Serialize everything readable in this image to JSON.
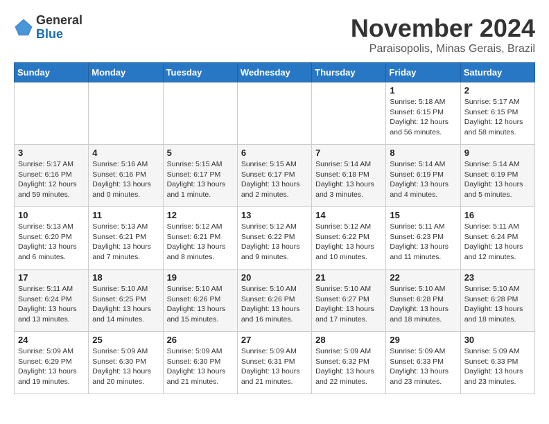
{
  "logo": {
    "general": "General",
    "blue": "Blue"
  },
  "header": {
    "month": "November 2024",
    "location": "Paraisopolis, Minas Gerais, Brazil"
  },
  "weekdays": [
    "Sunday",
    "Monday",
    "Tuesday",
    "Wednesday",
    "Thursday",
    "Friday",
    "Saturday"
  ],
  "weeks": [
    [
      {
        "day": "",
        "info": ""
      },
      {
        "day": "",
        "info": ""
      },
      {
        "day": "",
        "info": ""
      },
      {
        "day": "",
        "info": ""
      },
      {
        "day": "",
        "info": ""
      },
      {
        "day": "1",
        "info": "Sunrise: 5:18 AM\nSunset: 6:15 PM\nDaylight: 12 hours and 56 minutes."
      },
      {
        "day": "2",
        "info": "Sunrise: 5:17 AM\nSunset: 6:15 PM\nDaylight: 12 hours and 58 minutes."
      }
    ],
    [
      {
        "day": "3",
        "info": "Sunrise: 5:17 AM\nSunset: 6:16 PM\nDaylight: 12 hours and 59 minutes."
      },
      {
        "day": "4",
        "info": "Sunrise: 5:16 AM\nSunset: 6:16 PM\nDaylight: 13 hours and 0 minutes."
      },
      {
        "day": "5",
        "info": "Sunrise: 5:15 AM\nSunset: 6:17 PM\nDaylight: 13 hours and 1 minute."
      },
      {
        "day": "6",
        "info": "Sunrise: 5:15 AM\nSunset: 6:17 PM\nDaylight: 13 hours and 2 minutes."
      },
      {
        "day": "7",
        "info": "Sunrise: 5:14 AM\nSunset: 6:18 PM\nDaylight: 13 hours and 3 minutes."
      },
      {
        "day": "8",
        "info": "Sunrise: 5:14 AM\nSunset: 6:19 PM\nDaylight: 13 hours and 4 minutes."
      },
      {
        "day": "9",
        "info": "Sunrise: 5:14 AM\nSunset: 6:19 PM\nDaylight: 13 hours and 5 minutes."
      }
    ],
    [
      {
        "day": "10",
        "info": "Sunrise: 5:13 AM\nSunset: 6:20 PM\nDaylight: 13 hours and 6 minutes."
      },
      {
        "day": "11",
        "info": "Sunrise: 5:13 AM\nSunset: 6:21 PM\nDaylight: 13 hours and 7 minutes."
      },
      {
        "day": "12",
        "info": "Sunrise: 5:12 AM\nSunset: 6:21 PM\nDaylight: 13 hours and 8 minutes."
      },
      {
        "day": "13",
        "info": "Sunrise: 5:12 AM\nSunset: 6:22 PM\nDaylight: 13 hours and 9 minutes."
      },
      {
        "day": "14",
        "info": "Sunrise: 5:12 AM\nSunset: 6:22 PM\nDaylight: 13 hours and 10 minutes."
      },
      {
        "day": "15",
        "info": "Sunrise: 5:11 AM\nSunset: 6:23 PM\nDaylight: 13 hours and 11 minutes."
      },
      {
        "day": "16",
        "info": "Sunrise: 5:11 AM\nSunset: 6:24 PM\nDaylight: 13 hours and 12 minutes."
      }
    ],
    [
      {
        "day": "17",
        "info": "Sunrise: 5:11 AM\nSunset: 6:24 PM\nDaylight: 13 hours and 13 minutes."
      },
      {
        "day": "18",
        "info": "Sunrise: 5:10 AM\nSunset: 6:25 PM\nDaylight: 13 hours and 14 minutes."
      },
      {
        "day": "19",
        "info": "Sunrise: 5:10 AM\nSunset: 6:26 PM\nDaylight: 13 hours and 15 minutes."
      },
      {
        "day": "20",
        "info": "Sunrise: 5:10 AM\nSunset: 6:26 PM\nDaylight: 13 hours and 16 minutes."
      },
      {
        "day": "21",
        "info": "Sunrise: 5:10 AM\nSunset: 6:27 PM\nDaylight: 13 hours and 17 minutes."
      },
      {
        "day": "22",
        "info": "Sunrise: 5:10 AM\nSunset: 6:28 PM\nDaylight: 13 hours and 18 minutes."
      },
      {
        "day": "23",
        "info": "Sunrise: 5:10 AM\nSunset: 6:28 PM\nDaylight: 13 hours and 18 minutes."
      }
    ],
    [
      {
        "day": "24",
        "info": "Sunrise: 5:09 AM\nSunset: 6:29 PM\nDaylight: 13 hours and 19 minutes."
      },
      {
        "day": "25",
        "info": "Sunrise: 5:09 AM\nSunset: 6:30 PM\nDaylight: 13 hours and 20 minutes."
      },
      {
        "day": "26",
        "info": "Sunrise: 5:09 AM\nSunset: 6:30 PM\nDaylight: 13 hours and 21 minutes."
      },
      {
        "day": "27",
        "info": "Sunrise: 5:09 AM\nSunset: 6:31 PM\nDaylight: 13 hours and 21 minutes."
      },
      {
        "day": "28",
        "info": "Sunrise: 5:09 AM\nSunset: 6:32 PM\nDaylight: 13 hours and 22 minutes."
      },
      {
        "day": "29",
        "info": "Sunrise: 5:09 AM\nSunset: 6:33 PM\nDaylight: 13 hours and 23 minutes."
      },
      {
        "day": "30",
        "info": "Sunrise: 5:09 AM\nSunset: 6:33 PM\nDaylight: 13 hours and 23 minutes."
      }
    ]
  ]
}
